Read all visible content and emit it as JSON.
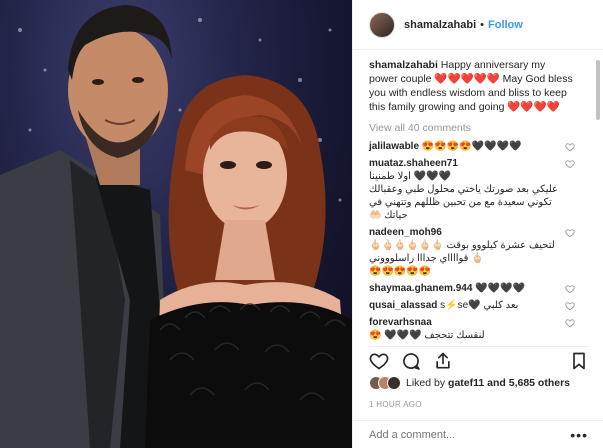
{
  "post": {
    "username": "shamalzahabi",
    "follow_label": "Follow",
    "separator": "•",
    "caption_text": "Happy anniversary my power couple ❤️❤️❤️❤️❤️ May God bless you with endless wisdom and bliss to keep this family growing and going ❤️❤️❤️❤️",
    "view_all_label": "View all 40 comments",
    "comments": [
      {
        "user": "jalilawable",
        "text": "😍😍😍😍🖤🖤🖤🖤"
      },
      {
        "user": "muataz.shaheen71",
        "text": "🖤🖤🖤 اولا طمنينا\nعليكي بعد صورتك ياختي محلول طبي وعقبالك\nتكوني سعيدة مع من تحبين ظللهم وتتهني في حياتك 🤲🏻"
      },
      {
        "user": "nadeen_moh96",
        "text": "لتحيف عشرة كيلووو بوقت 🖕🏻🖕🏻🖕🏻🖕🏻🖕🏻🖕🏻🖕🏻 قوااااي جدااا راسلوووني\n😍😍😍😍😍"
      },
      {
        "user": "shaymaa.ghanem.944",
        "text": "🖤🖤🖤🖤"
      },
      {
        "user": "qusai_alassad",
        "text": "s⚡se🖤 بعد كلبي"
      },
      {
        "user": "forevarhsnaa",
        "text": "لنفسك تتحجف 🖤🖤🖤 😍\nعشرة كيلو 🏃🏻 ب عشرين يووم 🏃🏻 راسلونو معي\n🖕🏻😍😍😍😍"
      }
    ],
    "liked_by_label": "Liked by",
    "liked_by_user": "gatef11",
    "likes_rest": "and 5,685 others",
    "timestamp": "1 HOUR AGO",
    "add_comment_placeholder": "Add a comment...",
    "more_label": "•••"
  },
  "colors": {
    "link_blue": "#3897f0",
    "muted_gray": "#999999",
    "text": "#262626",
    "border": "#efefef"
  },
  "icons": [
    "heart-icon",
    "comment-icon",
    "share-icon",
    "bookmark-icon"
  ]
}
